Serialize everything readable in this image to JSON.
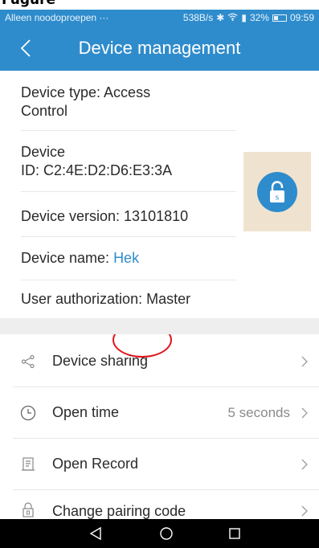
{
  "cropped_header": {
    "text": "Fugure"
  },
  "status_bar": {
    "carrier": "Alleen noodoproepen ···",
    "network_speed": "538B/s",
    "battery": "32%",
    "time": "09:59"
  },
  "app_bar": {
    "title": "Device management"
  },
  "device_info": {
    "type_line1": "Device type: Access",
    "type_line2": "Control",
    "id_line1": "Device",
    "id_line2": "ID: C2:4E:D2:D6:E3:3A",
    "version": "Device version: 13101810",
    "name_prefix": "Device name: ",
    "name_value": "Hek",
    "authorization": "User authorization: Master"
  },
  "menu": {
    "sharing": {
      "label": "Device sharing",
      "icon": "share-icon"
    },
    "open_time": {
      "label": "Open time",
      "value": "5 seconds",
      "icon": "clock-icon"
    },
    "open_record": {
      "label": "Open Record",
      "icon": "record-icon"
    },
    "pairing": {
      "label": "Change pairing code",
      "icon": "lock-icon"
    }
  },
  "lock_button": {
    "letter": "s",
    "color": "#2f8ccc",
    "background": "#efe3d0"
  },
  "annotation": {
    "color": "#e0141b"
  },
  "accent_color": "#2f8ccc"
}
